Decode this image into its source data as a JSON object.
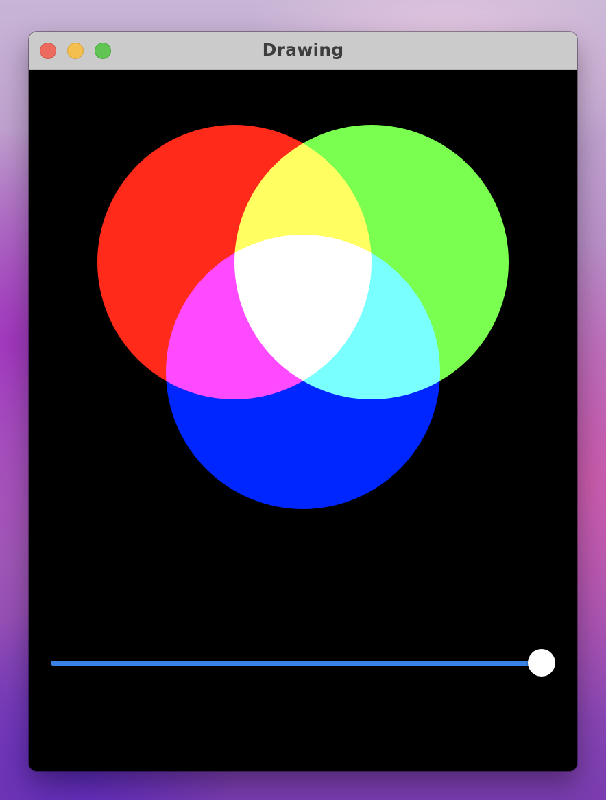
{
  "window": {
    "title": "Drawing"
  },
  "canvas": {
    "background": "#000000",
    "circles": [
      {
        "name": "red",
        "color": "#ff2a1a"
      },
      {
        "name": "green",
        "color": "#7aff50"
      },
      {
        "name": "blue",
        "color": "#0026ff"
      }
    ],
    "blend_mode": "screen"
  },
  "slider": {
    "value": 1.0,
    "accent": "#3b82e6"
  }
}
